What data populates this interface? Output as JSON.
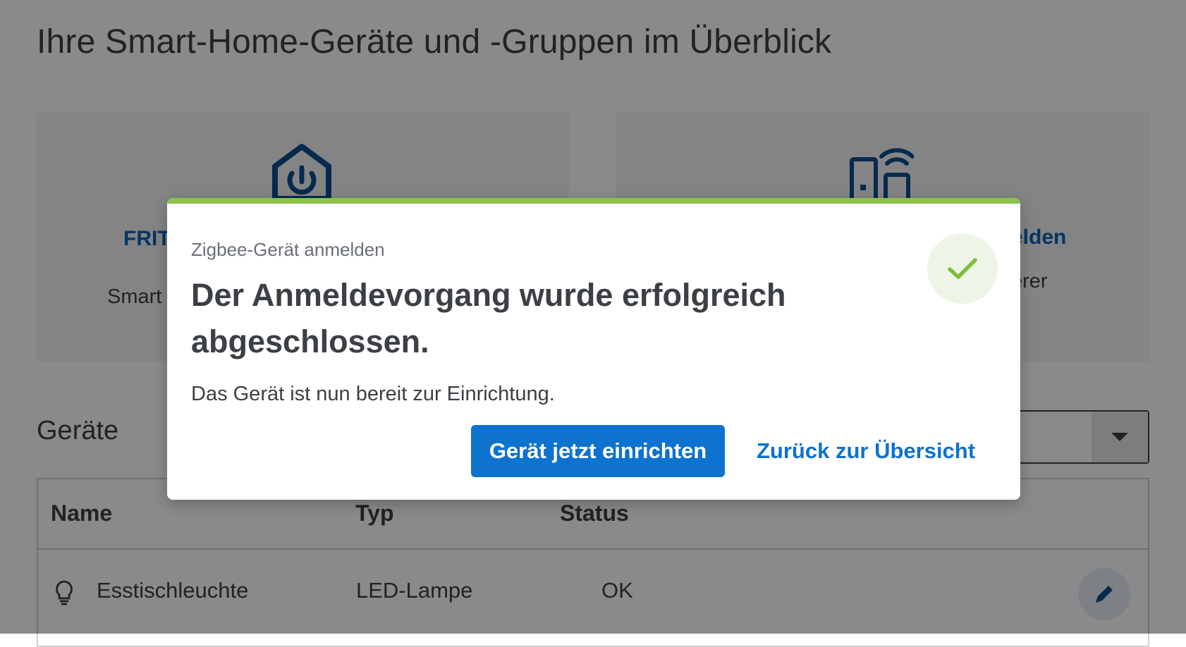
{
  "page": {
    "title": "Ihre Smart-Home-Geräte und -Gruppen im Überblick",
    "cards": [
      {
        "title": "FRIT",
        "text": "Smart",
        "icon": "smart-home-power-icon"
      },
      {
        "title": "elden",
        "text": "erer",
        "icon": "wireless-device-icon"
      }
    ],
    "devices_section": {
      "title": "Geräte",
      "table": {
        "headers": {
          "name": "Name",
          "type": "Typ",
          "status": "Status"
        },
        "rows": [
          {
            "icon": "lightbulb-icon",
            "name": "Esstischleuchte",
            "type": "LED-Lampe",
            "status": "OK"
          }
        ]
      }
    }
  },
  "modal": {
    "overline": "Zigbee-Gerät anmelden",
    "headline": "Der Anmeldevorgang wurde erfolgreich abgeschlossen.",
    "text": "Das Gerät ist nun bereit zur Einrichtung.",
    "primary_button": "Gerät jetzt einrichten",
    "secondary_button": "Zurück zur Übersicht",
    "accent_color": "#8bc34a",
    "icon": "checkmark-icon"
  },
  "colors": {
    "brand_blue": "#0e72cf",
    "success_green": "#8bc34a"
  }
}
